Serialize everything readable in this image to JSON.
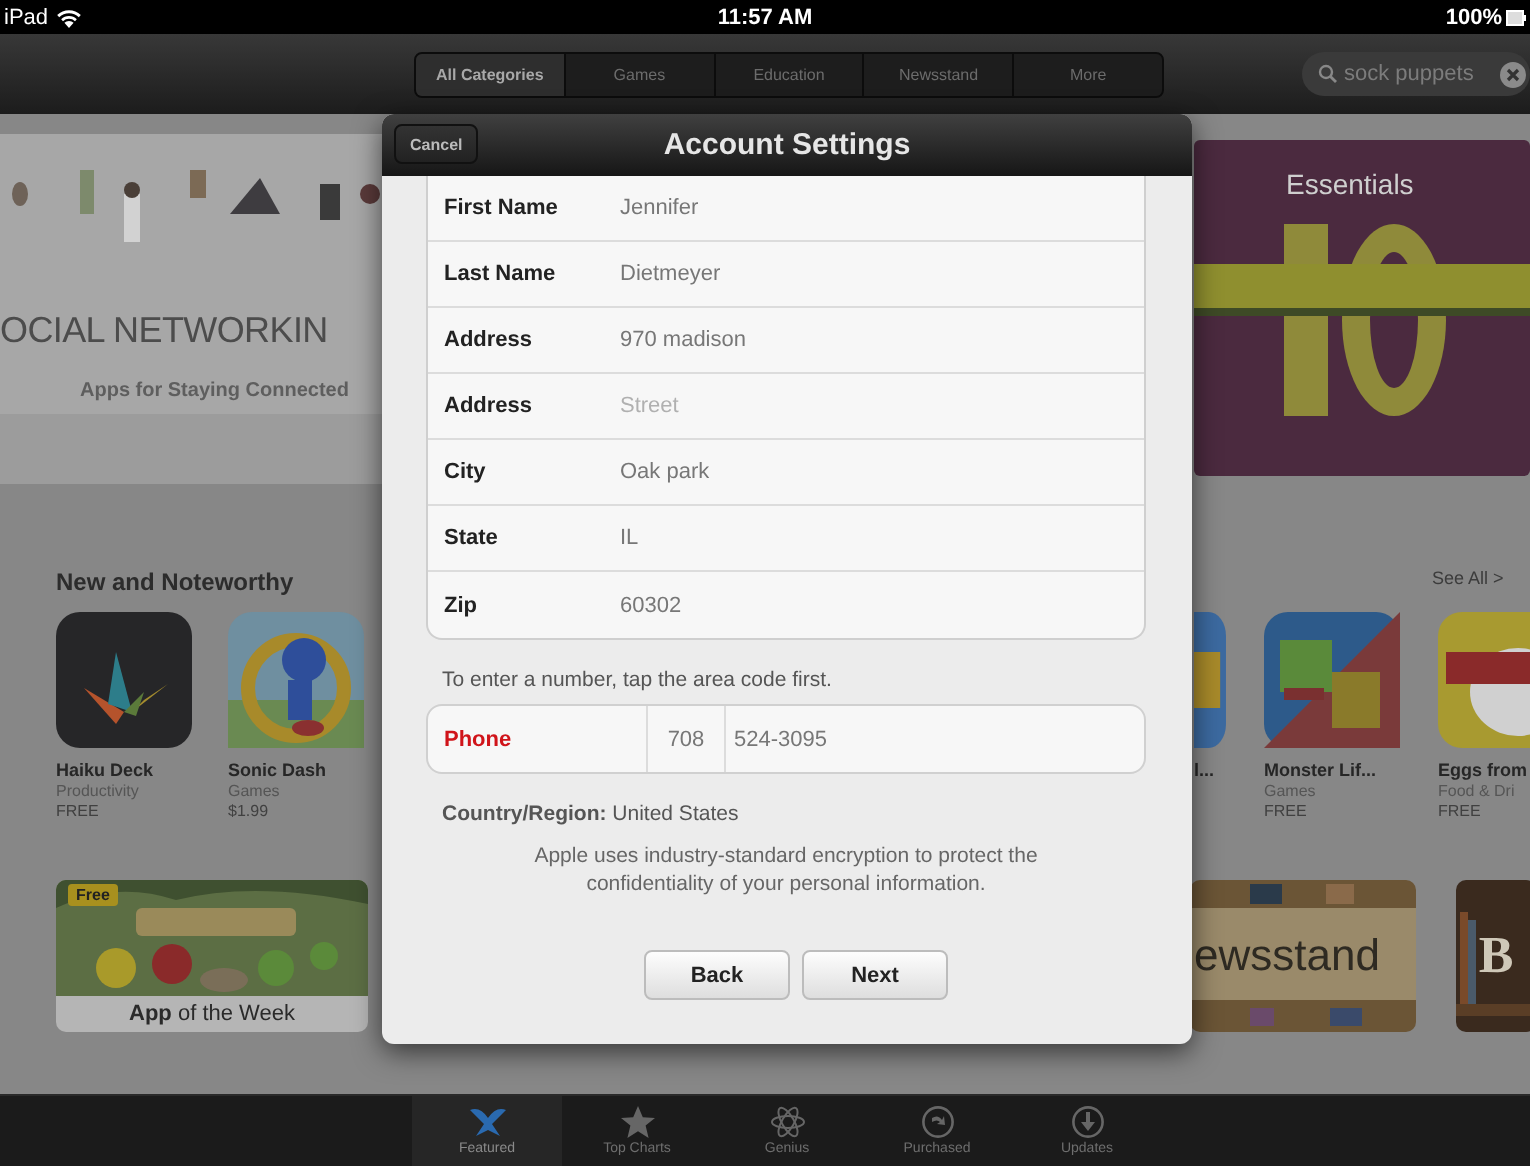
{
  "status_bar": {
    "device": "iPad",
    "time": "11:57 AM",
    "battery": "100%"
  },
  "category_tabs": [
    {
      "label": "All Categories",
      "selected": true
    },
    {
      "label": "Games",
      "selected": false
    },
    {
      "label": "Education",
      "selected": false
    },
    {
      "label": "Newsstand",
      "selected": false
    },
    {
      "label": "More",
      "selected": false
    }
  ],
  "search": {
    "value": "sock puppets"
  },
  "banners": [
    {
      "title": "OCIAL NETWORKIN",
      "subtitle": "Apps for Staying Connected"
    },
    {
      "title": "Essentials"
    }
  ],
  "section": {
    "title": "New and Noteworthy",
    "see_all": "See All >"
  },
  "apps_left": [
    {
      "name": "Haiku Deck",
      "category": "Productivity",
      "price": "FREE"
    },
    {
      "name": "Sonic Dash",
      "category": "Games",
      "price": "$1.99"
    }
  ],
  "apps_right": [
    {
      "name": "l..."
    },
    {
      "name": "Monster Lif...",
      "category": "Games",
      "price": "FREE"
    },
    {
      "name": "Eggs from",
      "category": "Food & Dri",
      "price": "FREE"
    }
  ],
  "promos": [
    {
      "badge": "Free",
      "caption": "**App** of the Week"
    },
    {
      "caption": "ewsstand"
    },
    {
      "caption": "B"
    }
  ],
  "dialog": {
    "cancel": "Cancel",
    "title": "Account Settings",
    "fields": [
      {
        "label": "First Name",
        "value": "Jennifer"
      },
      {
        "label": "Last Name",
        "value": "Dietmeyer"
      },
      {
        "label": "Address",
        "value": "970 madison"
      },
      {
        "label": "Address",
        "placeholder": "Street"
      },
      {
        "label": "City",
        "value": "Oak park"
      },
      {
        "label": "State",
        "value": "IL"
      },
      {
        "label": "Zip",
        "value": "60302"
      }
    ],
    "hint": "To enter a number, tap the area code first.",
    "phone": {
      "label": "Phone",
      "error": true,
      "area_code": "708",
      "number": "524-3095"
    },
    "country": "**Country/Region:** United States",
    "notice": "Apple uses industry-standard encryption to protect the confidentiality of your personal information.",
    "buttons": [
      "Back",
      "Next"
    ]
  },
  "tab_bar": [
    {
      "label": "Featured",
      "selected": true
    },
    {
      "label": "Top Charts",
      "selected": false
    },
    {
      "label": "Genius",
      "selected": false
    },
    {
      "label": "Purchased",
      "selected": false
    },
    {
      "label": "Updates",
      "selected": false
    }
  ]
}
